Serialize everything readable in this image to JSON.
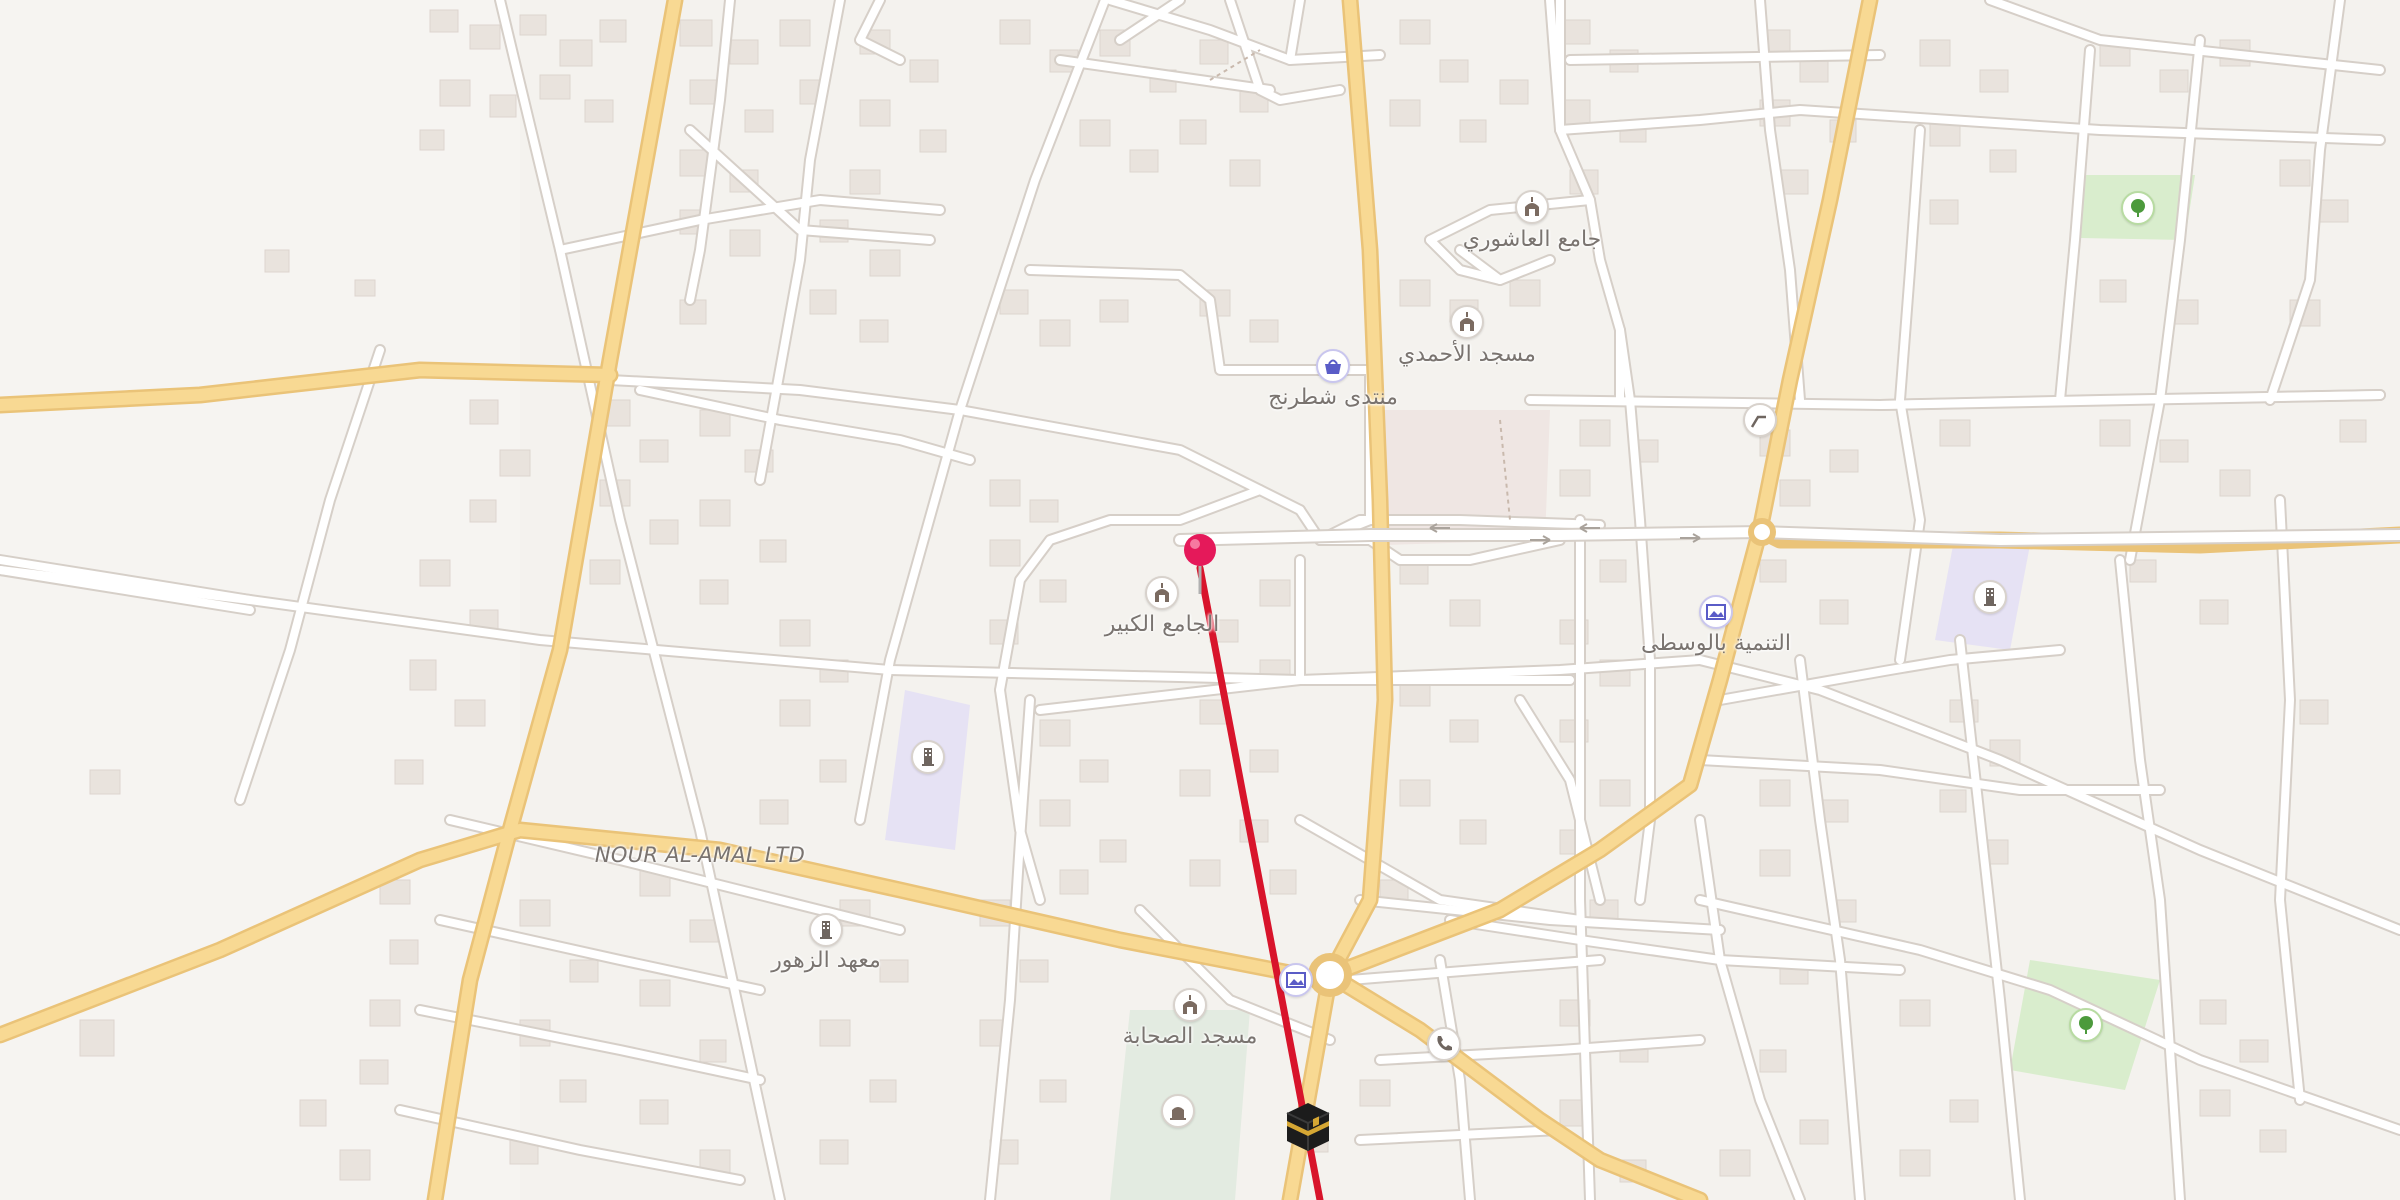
{
  "map": {
    "colors": {
      "background": "#f4f2ee",
      "building": "#e9e3dd",
      "street": "#ffffff",
      "main_road": "#f8d993",
      "main_road_casing": "#eac378",
      "route_line": "#d8142b",
      "pin": "#e5195a",
      "park": "#d9edcd",
      "education_area": "#e6e2f4"
    },
    "labels": {
      "mosque_ashouri": "جامع العاشوري",
      "mosque_ahmadi": "مسجد الأحمدي",
      "shop_shatranj": "منتدى شطرنج",
      "mosque_kabir": "الجامع الكبير",
      "development_center": "التنمية بالوسطى",
      "business_nour": "NOUR AL-AMAL LTD",
      "institute_zahour": "معهد الزهور",
      "mosque_sahaba": "مسجد الصحابة"
    },
    "icons": {
      "mosque": "mosque-icon",
      "shop": "shopping-basket-icon",
      "school": "school-icon",
      "museum": "gallery-icon",
      "park": "tree-icon",
      "phone": "phone-icon",
      "stairs": "stairs-icon",
      "shrine": "tomb-icon",
      "kaaba": "kaaba-icon",
      "pin": "location-pin-icon"
    }
  }
}
